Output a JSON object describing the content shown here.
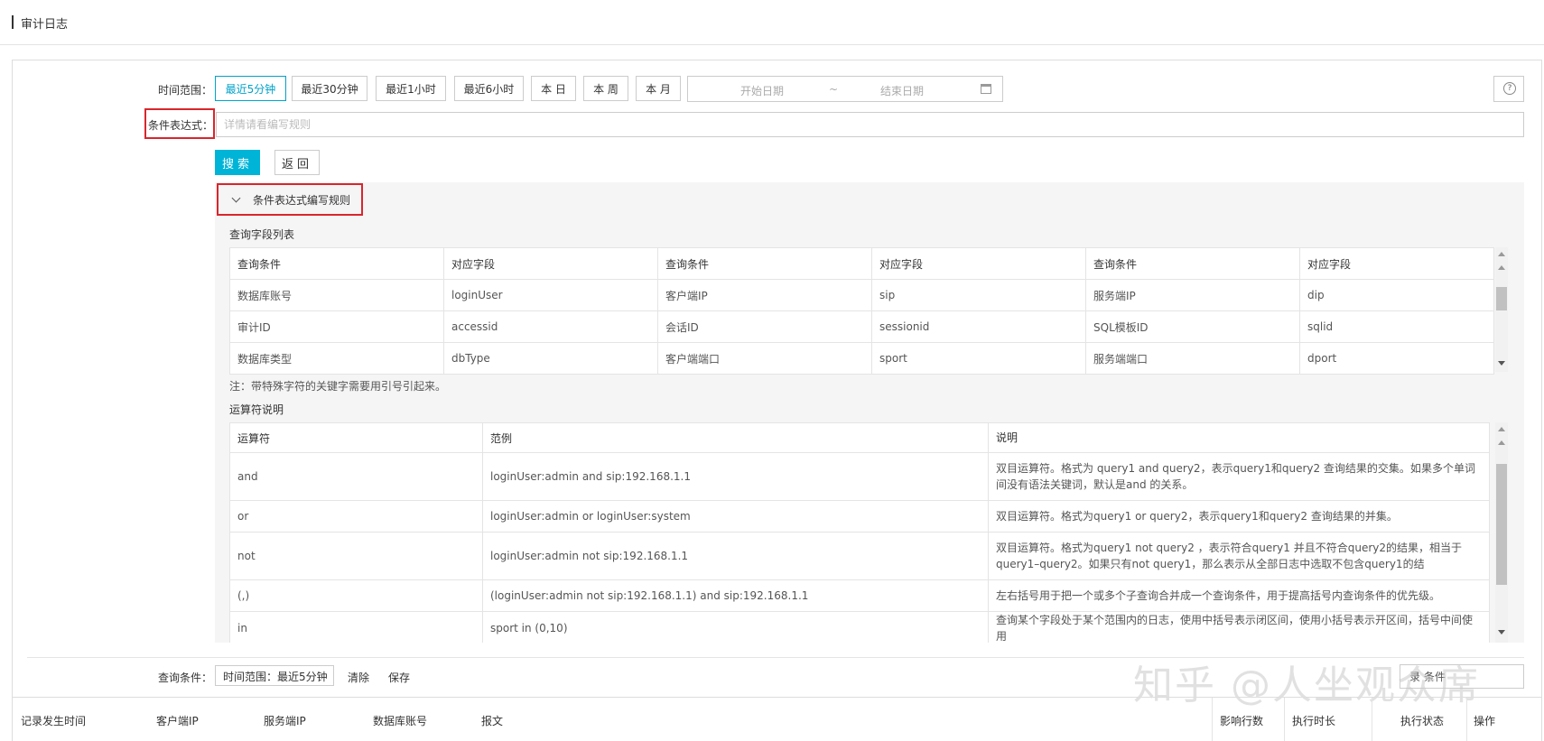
{
  "header": {
    "title": "审计日志"
  },
  "filter": {
    "time_range_label": "时间范围：",
    "time_buttons": [
      "最近5分钟",
      "最近30分钟",
      "最近1小时",
      "最近6小时",
      "本 日",
      "本 周",
      "本 月"
    ],
    "active_time_button": "最近5分钟",
    "date_start_placeholder": "开始日期",
    "date_separator": "~",
    "date_end_placeholder": "结束日期",
    "help_icon": "question-icon",
    "expr_label": "条件表达式：",
    "expr_placeholder": "详情请看编写规则",
    "search_label": "搜索",
    "back_label": "返回"
  },
  "rules": {
    "toggle_label": "条件表达式编写规则",
    "field_list_title": "查询字段列表",
    "field_table": {
      "headers": [
        "查询条件",
        "对应字段",
        "查询条件",
        "对应字段",
        "查询条件",
        "对应字段"
      ],
      "rows": [
        [
          "数据库账号",
          "loginUser",
          "客户端IP",
          "sip",
          "服务端IP",
          "dip"
        ],
        [
          "审计ID",
          "accessid",
          "会话ID",
          "sessionid",
          "SQL模板ID",
          "sqlid"
        ],
        [
          "数据库类型",
          "dbType",
          "客户端端口",
          "sport",
          "服务端端口",
          "dport"
        ]
      ]
    },
    "note": "注：带特殊字符的关键字需要用引号引起来。",
    "operator_title": "运算符说明",
    "operator_table": {
      "headers": [
        "运算符",
        "范例",
        "说明"
      ],
      "rows": [
        [
          "and",
          "loginUser:admin and sip:192.168.1.1",
          "双目运算符。格式为 query1 and query2，表示query1和query2 查询结果的交集。如果多个单词间没有语法关键词，默认是and 的关系。"
        ],
        [
          "or",
          "loginUser:admin or loginUser:system",
          "双目运算符。格式为query1 or query2，表示query1和query2 查询结果的并集。"
        ],
        [
          "not",
          "loginUser:admin not sip:192.168.1.1",
          "双目运算符。格式为query1 not query2 ，表示符合query1 并且不符合query2的结果，相当于query1–query2。如果只有not query1，那么表示从全部日志中选取不包含query1的结"
        ],
        [
          "(,)",
          "(loginUser:admin not sip:192.168.1.1) and sip:192.168.1.1",
          "左右括号用于把一个或多个子查询合并成一个查询条件，用于提高括号内查询条件的优先级。"
        ],
        [
          "in",
          "sport in (0,10)",
          "查询某个字段处于某个范围内的日志，使用中括号表示闭区间，使用小括号表示开区间，括号中间使用"
        ]
      ]
    }
  },
  "query_bar": {
    "label": "查询条件：",
    "tag": "时间范围：最近5分钟",
    "clear_label": "清除",
    "save_label": "保存",
    "right_partial": "录 条件"
  },
  "watermark": "知乎 @人坐观众席",
  "result_table": {
    "headers": [
      "记录发生时间",
      "客户端IP",
      "服务端IP",
      "数据库账号",
      "报文",
      "影响行数",
      "执行时长",
      "执行状态",
      "操作"
    ]
  }
}
